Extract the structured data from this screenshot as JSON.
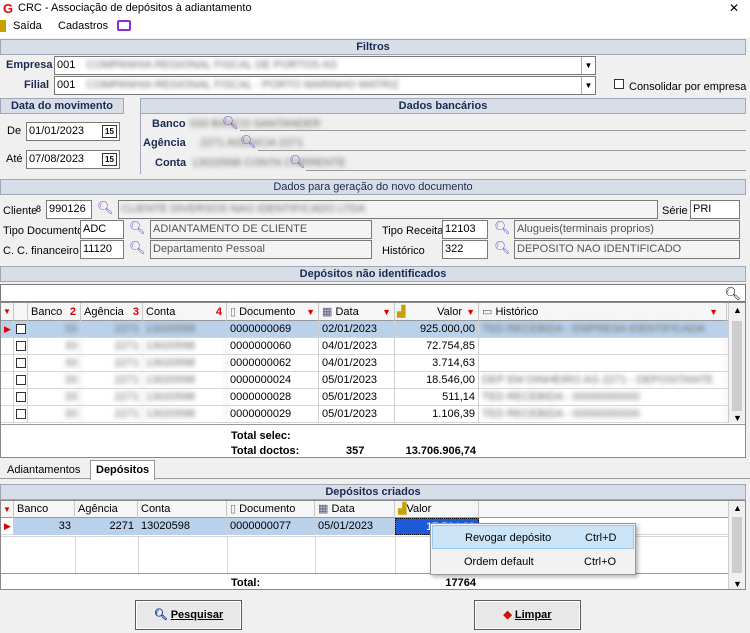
{
  "window": {
    "title": "CRC - Associação de depósitos à adiantamento",
    "close": "✕"
  },
  "menu": {
    "items": [
      "Saída",
      "Cadastros"
    ]
  },
  "filtros": {
    "title": "Filtros",
    "empresa_label": "Empresa",
    "empresa_value": "001",
    "empresa_blur": "COMPANHIA REGIONAL FISCAL DE PORTOS AS",
    "filial_label": "Filial",
    "filial_value": "001",
    "filial_blur": "COMPANHIA REGIONAL FISCAL - PORTO MARINHO MATRIZ",
    "consolidar_label": "Consolidar por empresa"
  },
  "data_movimento": {
    "title": "Data do movimento",
    "de_label": "De",
    "de_value": "01/01/2023",
    "ate_label": "Até",
    "ate_value": "07/08/2023",
    "cal": "15"
  },
  "dados_bancarios": {
    "title": "Dados bancários",
    "banco_label": "Banco",
    "agencia_label": "Agência",
    "conta_label": "Conta",
    "banco_blur": "033  BANCO SANTANDER",
    "agencia_blur": "2271  AGENCIA 2271",
    "conta_blur": "13020598  CONTA CORRENTE"
  },
  "novo_doc": {
    "title": "Dados para geração do novo documento",
    "cliente_label": "Cliente",
    "cliente_value": "990126",
    "cliente_blur": "CLIENTE DIVERSOS NAO IDENTIFICADO LTDA",
    "serie_label": "Série",
    "serie_value": "PRI",
    "tipo_doc_label": "Tipo Documento",
    "tipo_doc_value": "ADC",
    "tipo_doc_desc": "ADIANTAMENTO DE CLIENTE",
    "tipo_receita_label": "Tipo Receita",
    "tipo_receita_value": "12103",
    "tipo_receita_desc": "Alugueis(terminais proprios)",
    "cc_label": "C. C. financeiro",
    "cc_value": "11120",
    "cc_desc": "Departamento Pessoal",
    "historico_label": "Histórico",
    "historico_value": "322",
    "historico_desc": "DEPOSITO NAO IDENTIFICADO"
  },
  "depositos": {
    "title": "Depósitos não identificados",
    "columns": {
      "banco": "Banco",
      "banco_sort": "2",
      "agencia": "Agência",
      "agencia_sort": "3",
      "conta": "Conta",
      "conta_sort": "4",
      "documento": "Documento",
      "data": "Data",
      "valor": "Valor",
      "historico": "Histórico"
    },
    "rows": [
      {
        "banco": "33",
        "agencia": "2271",
        "conta": "13020598",
        "documento": "0000000069",
        "data": "02/01/2023",
        "valor": "925.000,00",
        "historico": "TED RECEBIDA - EMPRESA IDENTIFICADA"
      },
      {
        "banco": "33",
        "agencia": "2271",
        "conta": "13020598",
        "documento": "0000000060",
        "data": "04/01/2023",
        "valor": "72.754,85",
        "historico": ""
      },
      {
        "banco": "33",
        "agencia": "2271",
        "conta": "13020598",
        "documento": "0000000062",
        "data": "04/01/2023",
        "valor": "3.714,63",
        "historico": ""
      },
      {
        "banco": "33",
        "agencia": "2271",
        "conta": "13020598",
        "documento": "0000000024",
        "data": "05/01/2023",
        "valor": "18.546,00",
        "historico": "DEP EM DINHEIRO AG 2271 - DEPOSITANTE"
      },
      {
        "banco": "33",
        "agencia": "2271",
        "conta": "13020598",
        "documento": "0000000028",
        "data": "05/01/2023",
        "valor": "511,14",
        "historico": "TED RECEBIDA - 00000000000"
      },
      {
        "banco": "33",
        "agencia": "2271",
        "conta": "13020598",
        "documento": "0000000029",
        "data": "05/01/2023",
        "valor": "1.106,39",
        "historico": "TED RECEBIDA - 00000000000"
      }
    ],
    "total_selec_label": "Total selec:",
    "total_doctos_label": "Total doctos:",
    "total_doctos_count": "357",
    "total_doctos_valor": "13.706.906,74"
  },
  "tabs": [
    "Adiantamentos",
    "Depósitos"
  ],
  "criados": {
    "title": "Depósitos criados",
    "columns": {
      "banco": "Banco",
      "agencia": "Agência",
      "conta": "Conta",
      "documento": "Documento",
      "data": "Data",
      "valor": "Valor"
    },
    "rows": [
      {
        "banco": "33",
        "agencia": "2271",
        "conta": "13020598",
        "documento": "0000000077",
        "data": "05/01/2023",
        "valor": "17.764,00"
      }
    ],
    "total_label": "Total:",
    "total_value": "17764"
  },
  "context_menu": [
    {
      "label": "Revogar depósito",
      "shortcut": "Ctrl+D"
    },
    {
      "label": "Ordem default",
      "shortcut": "Ctrl+O"
    }
  ],
  "buttons": {
    "pesquisar": "Pesquisar",
    "limpar": "Limpar"
  },
  "colors": {
    "accent": "#7a4fd0",
    "header_bg": "#d8dee8",
    "selected": "#b9d1ea",
    "sort_red": "#d00"
  }
}
